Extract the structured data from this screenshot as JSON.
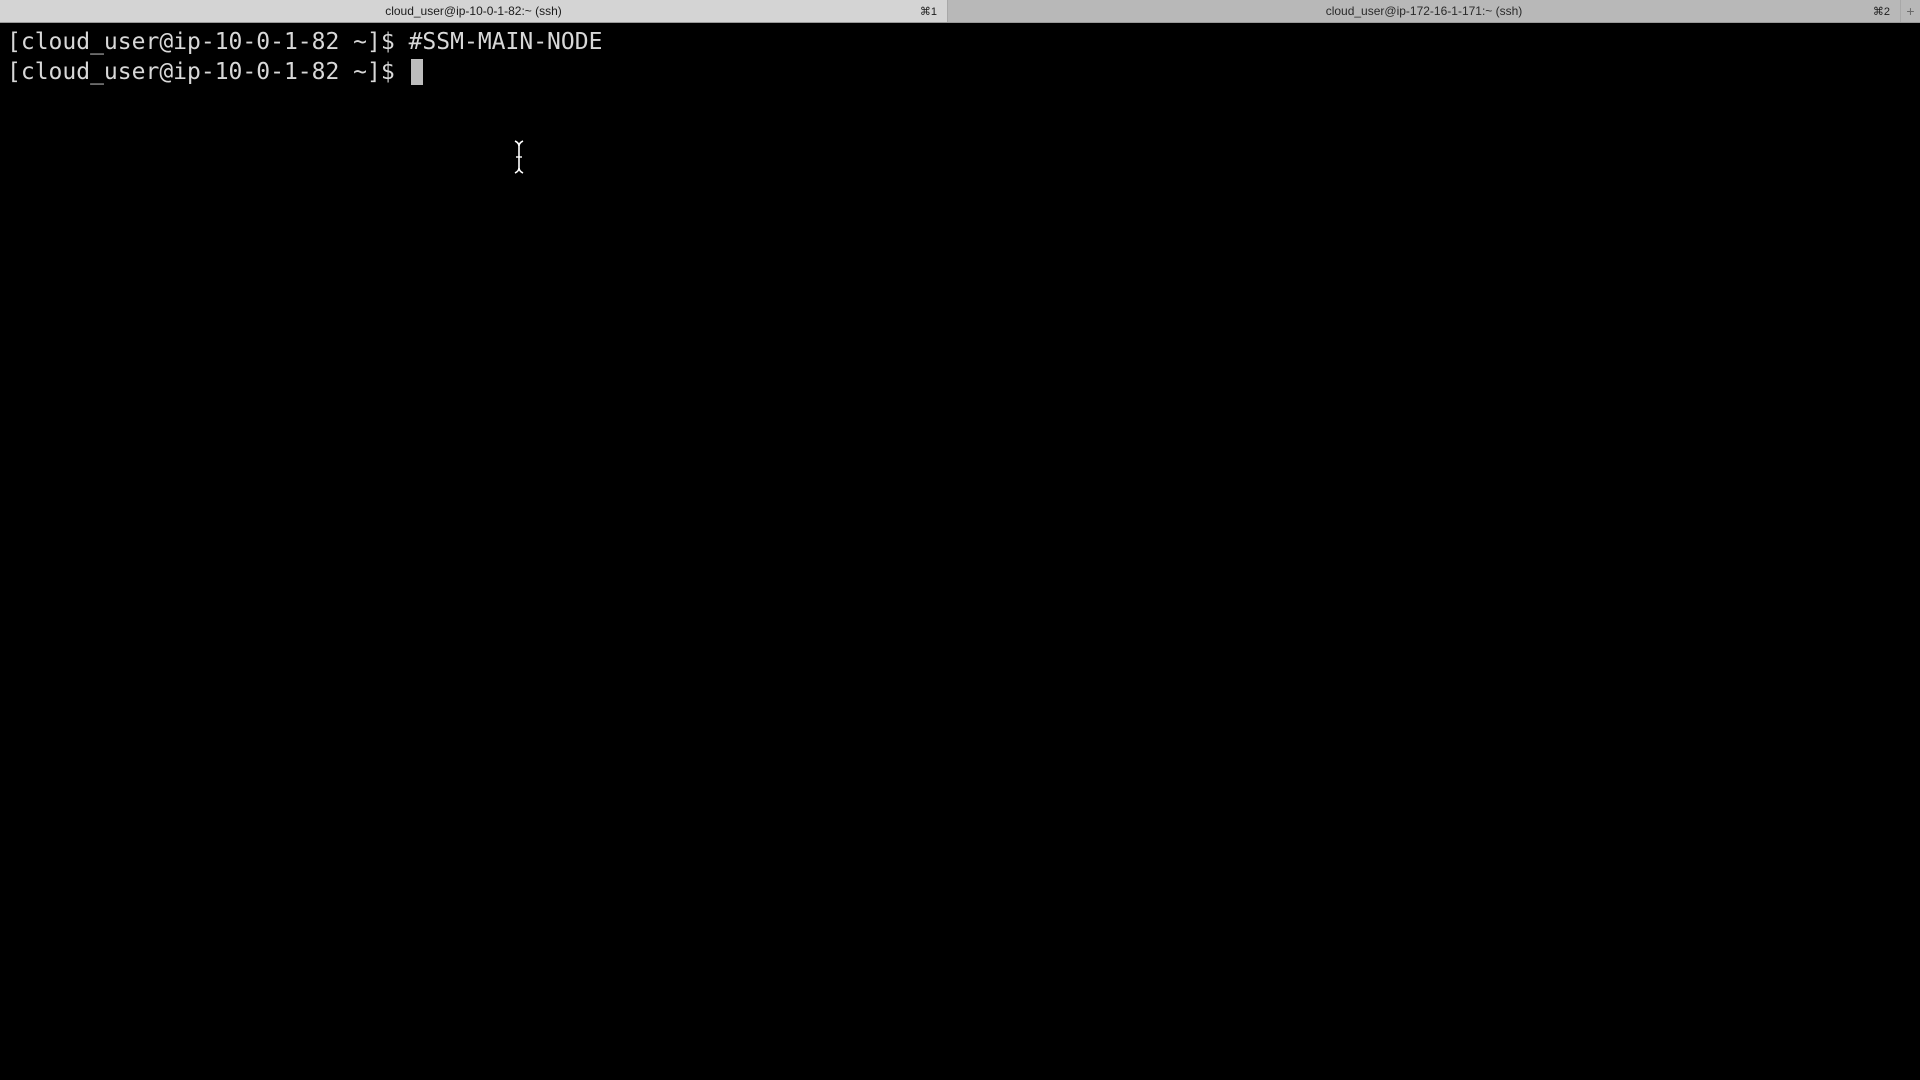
{
  "tabs": [
    {
      "title": "cloud_user@ip-10-0-1-82:~ (ssh)",
      "shortcut": "⌘1",
      "active": true
    },
    {
      "title": "cloud_user@ip-172-16-1-171:~ (ssh)",
      "shortcut": "⌘2",
      "active": false
    }
  ],
  "new_tab_label": "+",
  "terminal": {
    "lines": [
      {
        "prompt": "[cloud_user@ip-10-0-1-82 ~]$ ",
        "command": "#SSM-MAIN-NODE"
      },
      {
        "prompt": "[cloud_user@ip-10-0-1-82 ~]$ ",
        "command": ""
      }
    ]
  },
  "colors": {
    "terminal_bg": "#000000",
    "terminal_fg": "#d8d8d8",
    "tab_active_bg": "#d4d4d4",
    "tab_inactive_bg": "#b8b8b8"
  },
  "icons": {
    "mouse_pointer": "ibeam-cursor-icon",
    "new_tab": "plus-icon"
  }
}
